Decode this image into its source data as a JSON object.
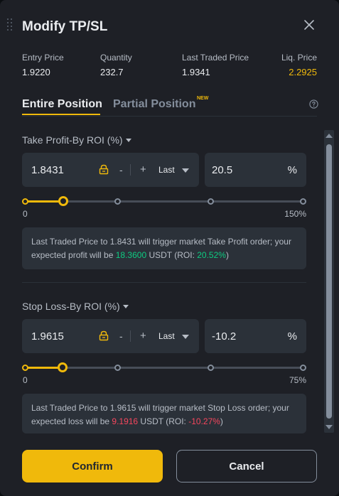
{
  "modal": {
    "title": "Modify TP/SL",
    "close_icon": "close-icon",
    "drag_icon": "drag-handle-icon"
  },
  "stats": [
    {
      "label": "Entry Price",
      "value": "1.9220"
    },
    {
      "label": "Quantity",
      "value": "232.7"
    },
    {
      "label": "Last Traded Price",
      "value": "1.9341"
    },
    {
      "label": "Liq. Price",
      "value": "2.2925"
    }
  ],
  "colors": {
    "accent": "#f0b90b",
    "liq_price": "#f0b90b",
    "profit": "#0ecb81",
    "loss": "#f6465d",
    "background": "#1e2026",
    "field": "#2b3139"
  },
  "tabs": {
    "entire": "Entire Position",
    "partial": "Partial Position",
    "new_badge": "NEW",
    "active": "entire",
    "help_icon": "question-circle-icon"
  },
  "take_profit": {
    "title": "Take Profit-By ROI (%)",
    "price": "1.8431",
    "minus": "-",
    "plus": "+",
    "price_type": "Last",
    "roi": "20.5",
    "roi_unit": "%",
    "slider_min": "0",
    "slider_max": "150%",
    "slider_level_pct": 20.5,
    "note_1": "Last Traded Price to 1.8431 will trigger market Take Profit order; your expected profit will be ",
    "note_amount": "18.3600",
    "note_2": " USDT (ROI: ",
    "note_roi": "20.52%",
    "note_3": ")"
  },
  "stop_loss": {
    "title": "Stop Loss-By ROI (%)",
    "price": "1.9615",
    "minus": "-",
    "plus": "+",
    "price_type": "Last",
    "roi": "-10.2",
    "roi_unit": "%",
    "slider_min": "0",
    "slider_max": "75%",
    "slider_level_pct": 10.2,
    "note_1": "Last Traded Price to 1.9615 will trigger market Stop Loss order; your expected loss will be ",
    "note_amount": "9.1916",
    "note_2": " USDT (ROI: ",
    "note_roi": "-10.27%",
    "note_3": ")"
  },
  "actions": {
    "confirm": "Confirm",
    "cancel": "Cancel"
  }
}
